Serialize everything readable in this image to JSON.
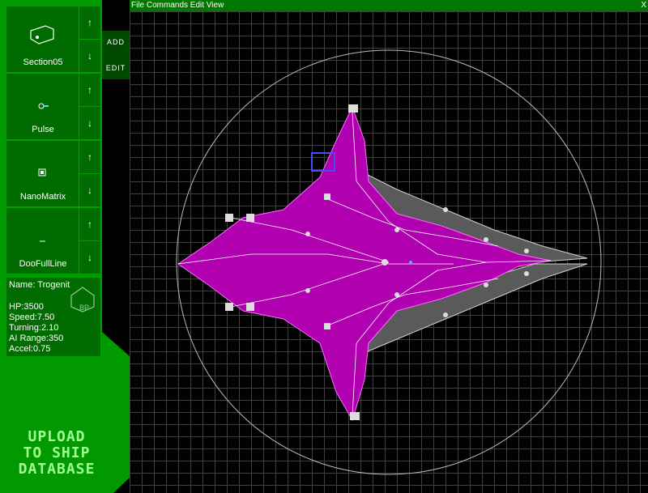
{
  "menu": {
    "label": "File Commands Edit View",
    "close": "X"
  },
  "tabs": {
    "add": "ADD",
    "edit": "EDIT"
  },
  "parts": [
    {
      "label": "Section05",
      "icon": "hull-section-icon"
    },
    {
      "label": "Pulse",
      "icon": "pulse-weapon-icon"
    },
    {
      "label": "NanoMatrix",
      "icon": "nanomatrix-icon"
    },
    {
      "label": "DooFullLine",
      "icon": "line-icon"
    }
  ],
  "arrows": {
    "up": "↑",
    "down": "↓"
  },
  "ship": {
    "name": "Name: Trogenit",
    "badge": "BP",
    "hp": "HP:3500",
    "speed": "Speed:7.50",
    "turning": "Turning:2.10",
    "ai_range": "AI Range:350",
    "accel": "Accel:0.75"
  },
  "upload": [
    "UPLOAD",
    "TO SHIP",
    "DATABASE"
  ],
  "colors": {
    "panel": "#006c00",
    "sidebar": "#009a00",
    "menubar": "#007800",
    "hull": "#c000c0",
    "accent": "#a0ff90"
  }
}
